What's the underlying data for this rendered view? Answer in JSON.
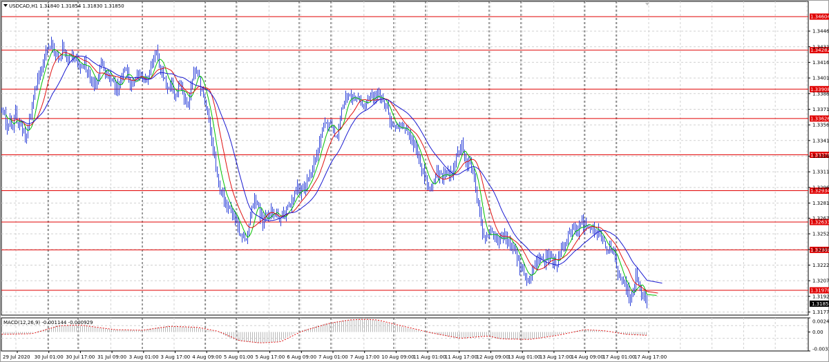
{
  "chart_data": [
    {
      "type": "line",
      "subtype": "ohlc-bars",
      "title": "USDCAD,H1  1.31840 1.31854 1.31830 1.31850",
      "timeframe": "H1",
      "ylim": [
        1.3174,
        1.3475
      ],
      "price_ticks": [
        "1.34465",
        "1.34315",
        "1.34165",
        "1.34015",
        "1.33865",
        "1.33715",
        "1.33565",
        "1.33415",
        "1.33265",
        "1.33115",
        "1.32965",
        "1.32815",
        "1.32670",
        "1.32520",
        "1.32370",
        "1.32220",
        "1.32070",
        "1.31920",
        "1.31770"
      ],
      "x_labels": [
        "29 Jul 2020",
        "30 Jul 01:00",
        "30 Jul 17:00",
        "31 Jul 09:00",
        "3 Aug 01:00",
        "3 Aug 17:00",
        "4 Aug 09:00",
        "5 Aug 01:00",
        "5 Aug 17:00",
        "6 Aug 09:00",
        "7 Aug 01:00",
        "7 Aug 17:00",
        "10 Aug 09:00",
        "11 Aug 01:00",
        "11 Aug 17:00",
        "12 Aug 09:00",
        "13 Aug 01:00",
        "13 Aug 17:00",
        "14 Aug 09:00",
        "17 Aug 01:00",
        "17 Aug 17:00"
      ],
      "horizontal_levels": [
        1.34604,
        1.34282,
        1.33908,
        1.33626,
        1.33278,
        1.32934,
        1.32633,
        1.32366,
        1.31978
      ],
      "current_price": 1.3185,
      "anchors": [
        [
          0,
          1.3374
        ],
        [
          4,
          1.3366
        ],
        [
          8,
          1.335
        ],
        [
          12,
          1.3362
        ],
        [
          16,
          1.3352
        ],
        [
          20,
          1.337
        ],
        [
          24,
          1.3355
        ],
        [
          30,
          1.3352
        ],
        [
          36,
          1.3345
        ],
        [
          44,
          1.3375
        ],
        [
          50,
          1.3395
        ],
        [
          56,
          1.3408
        ],
        [
          64,
          1.3425
        ],
        [
          72,
          1.3432
        ],
        [
          80,
          1.342
        ],
        [
          88,
          1.3428
        ],
        [
          96,
          1.3418
        ],
        [
          104,
          1.3425
        ],
        [
          112,
          1.341
        ],
        [
          120,
          1.3418
        ],
        [
          128,
          1.3402
        ],
        [
          136,
          1.3395
        ],
        [
          144,
          1.3412
        ],
        [
          152,
          1.3405
        ],
        [
          160,
          1.3398
        ],
        [
          168,
          1.3388
        ],
        [
          174,
          1.3405
        ],
        [
          180,
          1.3412
        ],
        [
          186,
          1.3392
        ],
        [
          192,
          1.34
        ],
        [
          198,
          1.3408
        ],
        [
          204,
          1.3395
        ],
        [
          210,
          1.3402
        ],
        [
          216,
          1.3412
        ],
        [
          222,
          1.3428
        ],
        [
          228,
          1.3415
        ],
        [
          234,
          1.3404
        ],
        [
          240,
          1.3395
        ],
        [
          246,
          1.3392
        ],
        [
          252,
          1.3386
        ],
        [
          258,
          1.3394
        ],
        [
          264,
          1.3382
        ],
        [
          270,
          1.3375
        ],
        [
          276,
          1.34
        ],
        [
          282,
          1.341
        ],
        [
          288,
          1.3392
        ],
        [
          294,
          1.3378
        ],
        [
          300,
          1.336
        ],
        [
          306,
          1.333
        ],
        [
          312,
          1.3305
        ],
        [
          318,
          1.3295
        ],
        [
          324,
          1.328
        ],
        [
          330,
          1.3275
        ],
        [
          336,
          1.3268
        ],
        [
          342,
          1.3258
        ],
        [
          348,
          1.325
        ],
        [
          354,
          1.3242
        ],
        [
          360,
          1.3268
        ],
        [
          366,
          1.3282
        ],
        [
          372,
          1.3275
        ],
        [
          378,
          1.3262
        ],
        [
          384,
          1.3268
        ],
        [
          390,
          1.3278
        ],
        [
          396,
          1.3272
        ],
        [
          402,
          1.3262
        ],
        [
          408,
          1.327
        ],
        [
          414,
          1.3278
        ],
        [
          420,
          1.3285
        ],
        [
          426,
          1.3298
        ],
        [
          432,
          1.329
        ],
        [
          438,
          1.3295
        ],
        [
          444,
          1.3305
        ],
        [
          450,
          1.3315
        ],
        [
          456,
          1.3325
        ],
        [
          462,
          1.3345
        ],
        [
          468,
          1.3355
        ],
        [
          474,
          1.336
        ],
        [
          480,
          1.335
        ],
        [
          486,
          1.3345
        ],
        [
          492,
          1.337
        ],
        [
          498,
          1.3382
        ],
        [
          504,
          1.3385
        ],
        [
          510,
          1.338
        ],
        [
          516,
          1.3385
        ],
        [
          522,
          1.3376
        ],
        [
          528,
          1.338
        ],
        [
          534,
          1.3384
        ],
        [
          540,
          1.338
        ],
        [
          546,
          1.3385
        ],
        [
          552,
          1.3378
        ],
        [
          558,
          1.3372
        ],
        [
          564,
          1.3356
        ],
        [
          570,
          1.3352
        ],
        [
          576,
          1.3355
        ],
        [
          582,
          1.335
        ],
        [
          588,
          1.3352
        ],
        [
          594,
          1.334
        ],
        [
          600,
          1.3335
        ],
        [
          606,
          1.3318
        ],
        [
          612,
          1.3305
        ],
        [
          618,
          1.3298
        ],
        [
          624,
          1.33
        ],
        [
          630,
          1.3312
        ],
        [
          636,
          1.3305
        ],
        [
          642,
          1.331
        ],
        [
          648,
          1.3308
        ],
        [
          654,
          1.3312
        ],
        [
          660,
          1.333
        ],
        [
          666,
          1.3338
        ],
        [
          672,
          1.3318
        ],
        [
          678,
          1.332
        ],
        [
          684,
          1.3305
        ],
        [
          690,
          1.328
        ],
        [
          696,
          1.3248
        ],
        [
          702,
          1.325
        ],
        [
          708,
          1.3258
        ],
        [
          714,
          1.3248
        ],
        [
          720,
          1.3245
        ],
        [
          726,
          1.325
        ],
        [
          732,
          1.3245
        ],
        [
          738,
          1.3238
        ],
        [
          744,
          1.3235
        ],
        [
          750,
          1.3222
        ],
        [
          756,
          1.3212
        ],
        [
          762,
          1.3208
        ],
        [
          768,
          1.322
        ],
        [
          774,
          1.3225
        ],
        [
          780,
          1.323
        ],
        [
          786,
          1.3226
        ],
        [
          792,
          1.3232
        ],
        [
          798,
          1.3228
        ],
        [
          804,
          1.3224
        ],
        [
          810,
          1.3236
        ],
        [
          816,
          1.3246
        ],
        [
          822,
          1.3252
        ],
        [
          828,
          1.3258
        ],
        [
          834,
          1.3255
        ],
        [
          840,
          1.3262
        ],
        [
          846,
          1.3258
        ],
        [
          852,
          1.3262
        ],
        [
          858,
          1.3256
        ],
        [
          864,
          1.3254
        ],
        [
          870,
          1.3242
        ],
        [
          876,
          1.3238
        ],
        [
          882,
          1.324
        ],
        [
          888,
          1.3225
        ],
        [
          894,
          1.3212
        ],
        [
          900,
          1.3205
        ],
        [
          906,
          1.3198
        ],
        [
          912,
          1.319
        ],
        [
          918,
          1.3212
        ],
        [
          922,
          1.3205
        ],
        [
          928,
          1.3192
        ],
        [
          934,
          1.3185
        ]
      ]
    },
    {
      "type": "line",
      "title": "MACD(12,26,9) -0.001144 -0.000929",
      "value_ticks": [
        "0.00245",
        "0.00",
        "-0.00330"
      ],
      "ylim": [
        -0.0033,
        0.00245
      ],
      "macd_anchors": [
        [
          0,
          -0.0004
        ],
        [
          40,
          -0.0003
        ],
        [
          80,
          0.0011
        ],
        [
          110,
          0.0012
        ],
        [
          160,
          0.0004
        ],
        [
          200,
          0.0003
        ],
        [
          240,
          0.001
        ],
        [
          280,
          0.0008
        ],
        [
          310,
          0.0001
        ],
        [
          340,
          -0.0015
        ],
        [
          370,
          -0.0019
        ],
        [
          400,
          -0.0017
        ],
        [
          430,
          0.0001
        ],
        [
          470,
          0.0015
        ],
        [
          500,
          0.0021
        ],
        [
          520,
          0.0022
        ],
        [
          540,
          0.0021
        ],
        [
          570,
          0.0012
        ],
        [
          620,
          -0.0002
        ],
        [
          660,
          -0.0011
        ],
        [
          700,
          -0.0007
        ],
        [
          720,
          -0.0012
        ],
        [
          760,
          -0.0013
        ],
        [
          800,
          -0.0006
        ],
        [
          840,
          0.0004
        ],
        [
          870,
          0.0002
        ],
        [
          900,
          -0.0004
        ],
        [
          934,
          -0.0006
        ]
      ]
    }
  ]
}
